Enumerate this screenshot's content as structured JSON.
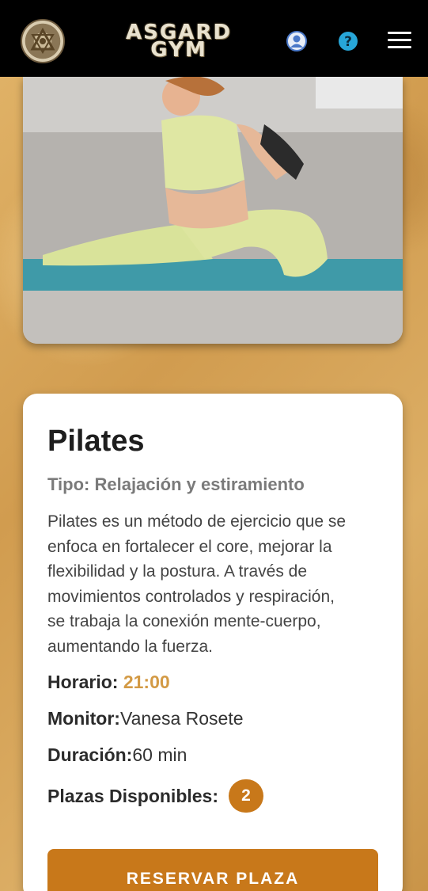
{
  "header": {
    "brand_line1": "ASGARD",
    "brand_line2": "GYM",
    "icons": [
      "logo-emblem",
      "user-icon",
      "help-icon",
      "menu-icon"
    ]
  },
  "activity": {
    "title": "Pilates",
    "type_text": "Tipo: Relajación y estiramiento",
    "description": "Pilates es un método de ejercicio que se enfoca en fortalecer el core, mejorar la flexibilidad y la postura. A través de movimientos controlados y respiración, se trabaja la conexión mente-cuerpo, aumentando la fuerza.",
    "horario_label": "Horario:",
    "horario_value": "21:00",
    "monitor_label": "Monitor:",
    "monitor_value": "Vanesa Rosete",
    "duracion_label": "Duración:",
    "duracion_value": "60 min",
    "plazas_label": "Plazas Disponibles:",
    "plazas_value": "2",
    "reserve_label": "RESERVAR PLAZA"
  },
  "colors": {
    "accent": "#c8781a",
    "horario": "#d39a45",
    "header_bg": "#000000"
  }
}
